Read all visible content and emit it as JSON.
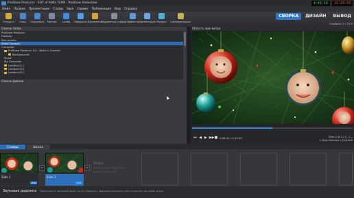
{
  "app": {
    "window_title": "ProShow Producer - SOT of KWD TEAM - ProShow Slideshow",
    "clock": [
      "4:41:16",
      "11:29:33"
    ],
    "show_title": "Show Slideshow"
  },
  "menu": [
    "Файл",
    "Правка",
    "Презентация",
    "Слайд",
    "Звук",
    "Сервис",
    "Публикация",
    "Вид",
    "Справка"
  ],
  "toolbar": [
    {
      "label": "Открыть",
      "icon": "folder-icon",
      "color": "#d9a93b"
    },
    {
      "label": "Сохр.",
      "icon": "save-icon",
      "color": "#4a88cf"
    },
    {
      "label": "Сохранить",
      "icon": "save-as-icon",
      "color": "#4a88cf"
    },
    {
      "label": "Мастер",
      "icon": "wizard-icon",
      "color": "#7e8aa0"
    },
    {
      "label": "Слайд",
      "icon": "slide-icon",
      "color": "#3c8fe0"
    },
    {
      "label": "Навороты",
      "icon": "effects-icon",
      "color": "#4f9fe8"
    },
    {
      "label": "Переменны",
      "icon": "transitions-icon",
      "color": "#e0a23a"
    },
    {
      "label": "Параметры слайда",
      "icon": "slide-options-icon",
      "color": "#8a8f99"
    },
    {
      "label": "Эффекты",
      "icon": "fx-icon",
      "color": "#5b9bd5"
    },
    {
      "label": "Презентация",
      "icon": "show-icon",
      "color": "#6fa6e6"
    },
    {
      "label": "Музыка",
      "icon": "music-icon",
      "color": "#4bb0d8"
    },
    {
      "label": "Синхронизация",
      "icon": "sync-icon",
      "color": "#c8b35a"
    }
  ],
  "modes": {
    "build": "СБОРКА",
    "design": "ДИЗАЙН",
    "publish": "ВЫВОД"
  },
  "subinfo": "Слайдов: 2 / 10:0",
  "folder_panel": {
    "header": "Список папок",
    "rows": [
      {
        "label": "ProShow Producer",
        "folder": false,
        "selected": false
      },
      {
        "label": "Desktop",
        "folder": false,
        "selected": false
      },
      {
        "label": "Documents",
        "folder": false,
        "selected": false
      },
      {
        "label": "Show Courses",
        "folder": false,
        "selected": true
      },
      {
        "label": "Computer",
        "folder": false,
        "selected": false
      },
      {
        "label": "ProShow Producer 5.0 - Build in Content",
        "folder": true,
        "selected": false
      },
      {
        "label": "Backgrounds",
        "folder": true,
        "selected": false
      },
      {
        "label": "Music",
        "folder": false,
        "selected": false
      },
      {
        "label": "My Computer",
        "folder": false,
        "selected": false
      },
      {
        "label": "Untitled (C:)",
        "folder": true,
        "selected": false
      },
      {
        "label": "Untitled (D:)",
        "folder": true,
        "selected": false
      },
      {
        "label": "Untitled (E:)",
        "folder": true,
        "selected": false
      }
    ]
  },
  "files_panel": {
    "header": "Список файлов"
  },
  "preview": {
    "header": "Область просмотра",
    "timecode": "0:06.00 / 0:12.00",
    "progress": 0.5,
    "slide_info_line1": "Slide 2 of 2 | 3 - 1...",
    "slide_info_line2": "1 Slide Selected | 0:06.000"
  },
  "tabs": [
    "Слайды",
    "Шкала"
  ],
  "slides": [
    {
      "number": "Slide 1",
      "duration": "3.0"
    },
    {
      "number": "Slide 2",
      "duration": "3.0"
    }
  ],
  "empty_slide": {
    "title": "Slides",
    "line1": "Drop photos / videos here.",
    "line2": "Double click to edit."
  },
  "audio": {
    "label": "Звуковая дорожка",
    "hint": "Перетащите звуковой файл на эту дорожку. Дважды щелкните для открытия настроек звука."
  }
}
